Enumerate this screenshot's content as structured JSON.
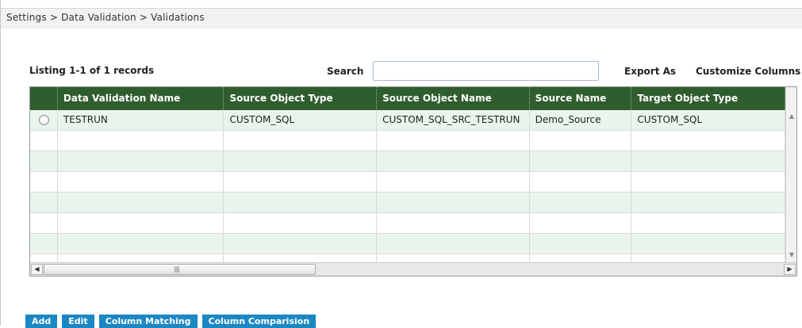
{
  "breadcrumb": "Settings > Data Validation > Validations",
  "listing": "Listing  1-1  of 1 records",
  "search": {
    "label": "Search",
    "value": ""
  },
  "toolbar": {
    "export_as": "Export As",
    "customize_columns": "Customize Columns"
  },
  "table": {
    "columns": [
      "",
      "Data Validation Name",
      "Source Object Type",
      "Source Object Name",
      "Source Name",
      "Target Object Type",
      "T"
    ],
    "rows": [
      [
        "",
        "TESTRUN",
        "CUSTOM_SQL",
        "CUSTOM_SQL_SRC_TESTRUN",
        "Demo_Source",
        "CUSTOM_SQL",
        "C"
      ],
      [
        "",
        "",
        "",
        "",
        "",
        "",
        ""
      ],
      [
        "",
        "",
        "",
        "",
        "",
        "",
        ""
      ],
      [
        "",
        "",
        "",
        "",
        "",
        "",
        ""
      ],
      [
        "",
        "",
        "",
        "",
        "",
        "",
        ""
      ],
      [
        "",
        "",
        "",
        "",
        "",
        "",
        ""
      ],
      [
        "",
        "",
        "",
        "",
        "",
        "",
        ""
      ],
      [
        "",
        "",
        "",
        "",
        "",
        "",
        ""
      ]
    ]
  },
  "actions": [
    "Add",
    "Edit",
    "Column Matching",
    "Column Comparision"
  ],
  "colors": {
    "header_bg": "#2f5d2e",
    "row_alt": "#e9f5ec",
    "button_bg": "#1b88c4"
  },
  "icons": {
    "scroll_left": "arrow-left-icon",
    "scroll_right": "arrow-right-icon",
    "scroll_up": "arrow-up-icon",
    "scroll_down": "arrow-down-icon"
  }
}
